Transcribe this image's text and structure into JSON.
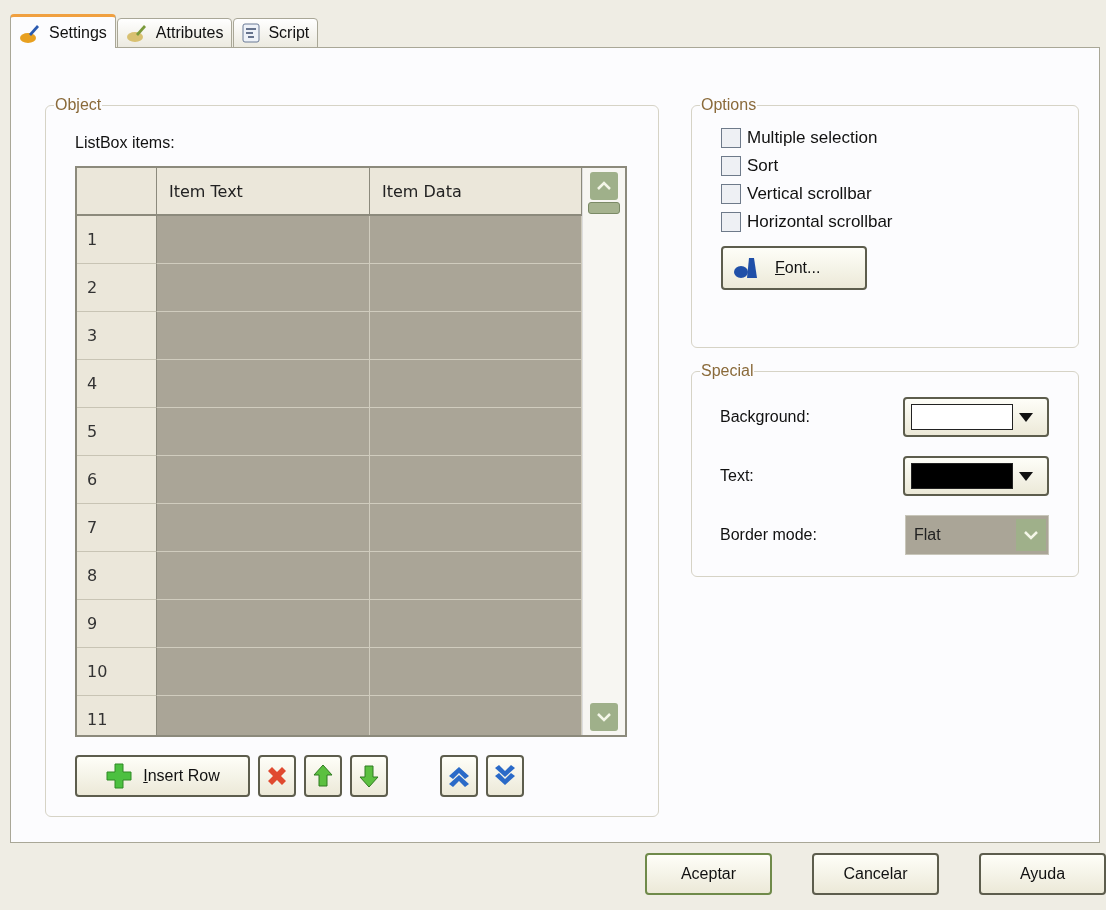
{
  "tabs": [
    {
      "label": "Settings",
      "kind": "settings",
      "selected": true
    },
    {
      "label": "Attributes",
      "kind": "attributes",
      "selected": false
    },
    {
      "label": "Script",
      "kind": "script",
      "selected": false
    }
  ],
  "object_group": {
    "title": "Object",
    "list_label": "ListBox items:",
    "table": {
      "columns": [
        "Item Text",
        "Item Data"
      ],
      "rows": [
        "1",
        "2",
        "3",
        "4",
        "5",
        "6",
        "7",
        "8",
        "9",
        "10",
        "11"
      ]
    },
    "insert_button": {
      "label": "Insert Row",
      "first_letter_underlined": true
    },
    "row_tools": [
      {
        "kind": "delete"
      },
      {
        "kind": "up"
      },
      {
        "kind": "down"
      },
      {
        "kind": "gap"
      },
      {
        "kind": "top"
      },
      {
        "kind": "bottom"
      }
    ]
  },
  "options_group": {
    "title": "Options",
    "checkboxes": [
      {
        "label": "Multiple selection",
        "checked": false
      },
      {
        "label": "Sort",
        "checked": false
      },
      {
        "label": "Vertical scrollbar",
        "checked": false
      },
      {
        "label": "Horizontal scrollbar",
        "checked": false
      }
    ],
    "font_button": {
      "label": "Font...",
      "first_letter_underlined": true
    }
  },
  "special_group": {
    "title": "Special",
    "fields": [
      {
        "label": "Background:",
        "kind": "color",
        "color": "#ffffff"
      },
      {
        "label": "Text:",
        "kind": "color",
        "color": "#000000"
      },
      {
        "label": "Border mode:",
        "kind": "select",
        "value": "Flat",
        "disabled": true
      }
    ]
  },
  "buttons": [
    {
      "label": "Aceptar",
      "default": true
    },
    {
      "label": "Cancelar",
      "default": false
    },
    {
      "label": "Ayuda",
      "default": false
    }
  ]
}
